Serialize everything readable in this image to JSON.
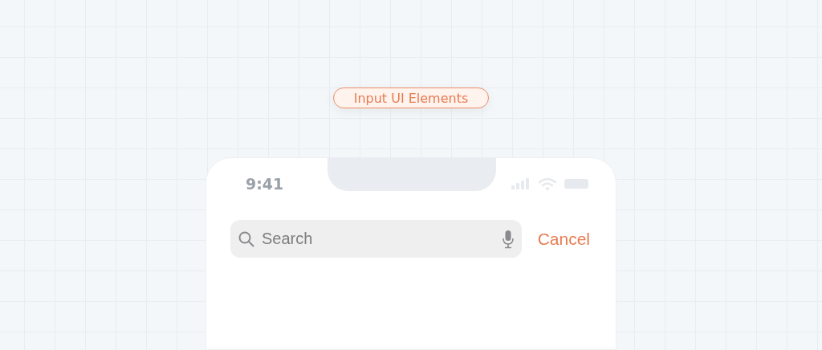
{
  "badge": {
    "label": "Input UI Elements"
  },
  "phone": {
    "status_bar": {
      "time": "9:41"
    },
    "search": {
      "placeholder": "Search"
    },
    "cancel": "Cancel"
  }
}
